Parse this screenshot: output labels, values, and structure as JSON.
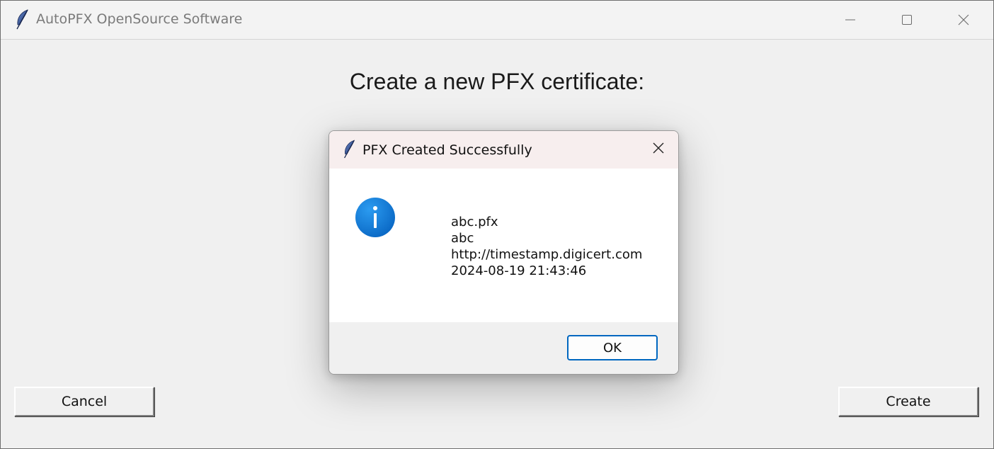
{
  "window": {
    "title": "AutoPFX OpenSource Software",
    "icon": "feather-icon",
    "caption_buttons": [
      "minimize-icon",
      "maximize-icon",
      "close-icon"
    ]
  },
  "main": {
    "heading": "Create a new PFX certificate:",
    "cancel_label": "Cancel",
    "create_label": "Create"
  },
  "dialog": {
    "title": "PFX Created Successfully",
    "icon": "feather-icon",
    "status_icon": "info-icon",
    "message_lines": [
      "abc.pfx",
      "abc",
      "http://timestamp.digicert.com",
      "2024-08-19 21:43:46"
    ],
    "ok_label": "OK"
  },
  "colors": {
    "window_bg": "#f0f0f0",
    "dialog_titlebar_bg": "#f7eeee",
    "info_blue": "#0b78d4",
    "focus_border": "#0067c0"
  }
}
